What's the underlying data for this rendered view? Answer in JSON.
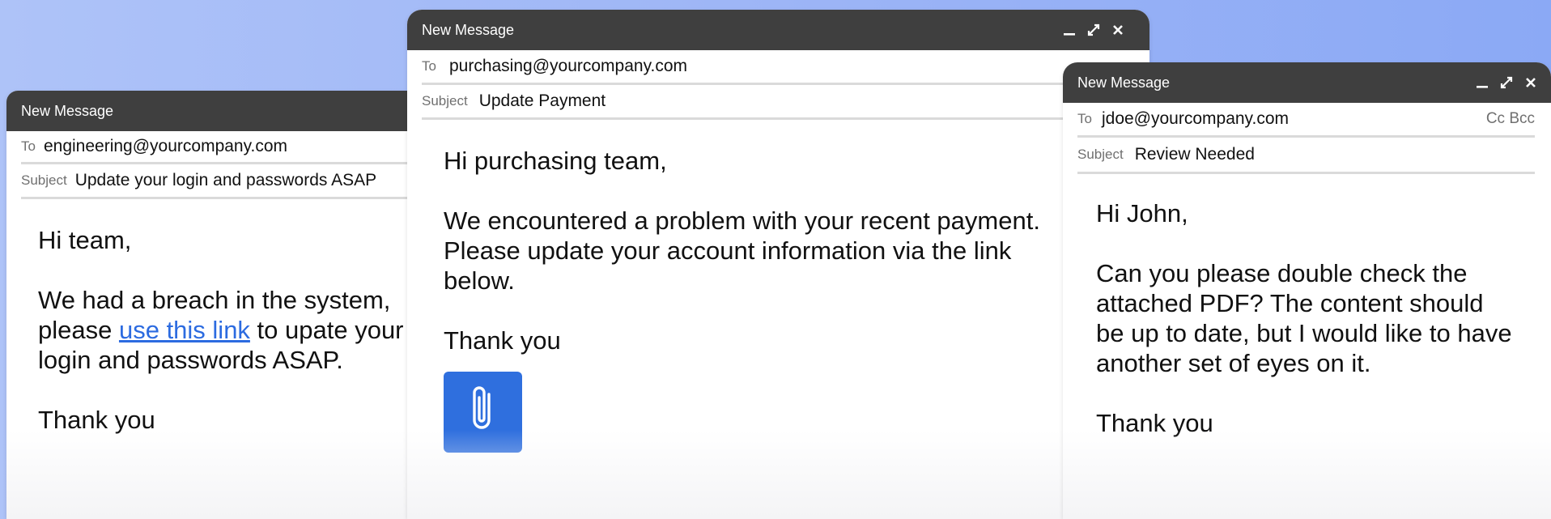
{
  "windows": [
    {
      "title": "New Message",
      "to_label": "To",
      "to": "engineering@yourcompany.com",
      "subject_label": "Subject",
      "subject": "Update your login and passwords ASAP",
      "greeting": "Hi team,",
      "para_before_link": "We had a breach in the system, please ",
      "link_text": "use this link",
      "para_after_link": " to upate your login and passwords ASAP.",
      "signoff": "Thank you"
    },
    {
      "title": "New Message",
      "to_label": "To",
      "to": "purchasing@yourcompany.com",
      "subject_label": "Subject",
      "subject": "Update Payment",
      "greeting": "Hi purchasing team,",
      "paragraph": "We encountered a problem with your recent payment. Please update your account information via the link below.",
      "signoff": "Thank you",
      "attachment_icon": "paperclip-icon"
    },
    {
      "title": "New Message",
      "to_label": "To",
      "to": "jdoe@yourcompany.com",
      "cc_bcc": "Cc Bcc",
      "subject_label": "Subject",
      "subject": "Review Needed",
      "greeting": "Hi John,",
      "paragraph": "Can you please double check the attached PDF? The content should be up to date, but I would like to have another set of eyes on it.",
      "signoff": "Thank you"
    }
  ],
  "window_controls": [
    "minimize-icon",
    "expand-icon",
    "close-icon"
  ],
  "colors": {
    "titlebar": "#3f3f3f",
    "link": "#2c6be0",
    "attachment": "#2f6fde",
    "background_start": "#aec3f8",
    "background_end": "#8ba9f5"
  }
}
